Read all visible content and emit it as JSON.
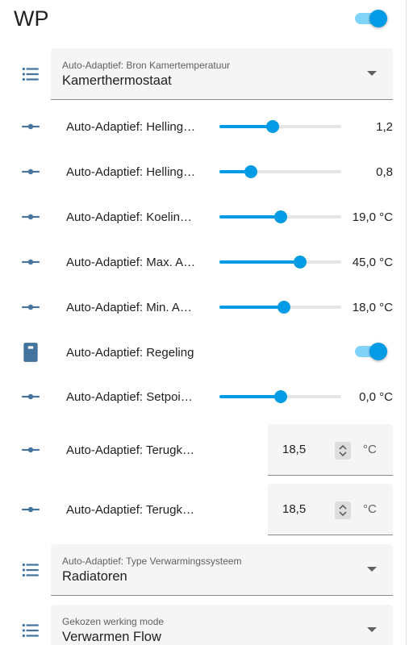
{
  "header": {
    "title": "WP",
    "toggle_on": true
  },
  "selects": {
    "bron": {
      "label": "Auto-Adaptief: Bron Kamertemperatuur",
      "value": "Kamerthermostaat"
    },
    "type": {
      "label": "Auto-Adaptief: Type Verwarmingssysteem",
      "value": "Radiatoren"
    },
    "mode": {
      "label": "Gekozen werking mode",
      "value": "Verwarmen Flow"
    }
  },
  "sliders": [
    {
      "label": "Auto-Adaptief: Helling…",
      "value": "1,2",
      "fraction": 0.44
    },
    {
      "label": "Auto-Adaptief: Helling…",
      "value": "0,8",
      "fraction": 0.26
    },
    {
      "label": "Auto-Adaptief: Koelin…",
      "value": "19,0 °C",
      "fraction": 0.5
    },
    {
      "label": "Auto-Adaptief: Max. A…",
      "value": "45,0 °C",
      "fraction": 0.66
    },
    {
      "label": "Auto-Adaptief: Min. A…",
      "value": "18,0 °C",
      "fraction": 0.53
    },
    {
      "label": "Auto-Adaptief: Setpoi…",
      "value": "0,0 °C",
      "fraction": 0.5
    }
  ],
  "regeling": {
    "label": "Auto-Adaptief: Regeling",
    "toggle_on": true
  },
  "numbers": [
    {
      "label": "Auto-Adaptief: Terugk…",
      "value": "18,5",
      "unit": "°C"
    },
    {
      "label": "Auto-Adaptief: Terugk…",
      "value": "18,5",
      "unit": "°C"
    }
  ],
  "icons": {
    "select": "format-list-bulleted-icon",
    "slider": "ray-vertex-icon",
    "switch": "light-switch-icon"
  },
  "colors": {
    "accent": "#039be5",
    "icon": "#44739e"
  }
}
